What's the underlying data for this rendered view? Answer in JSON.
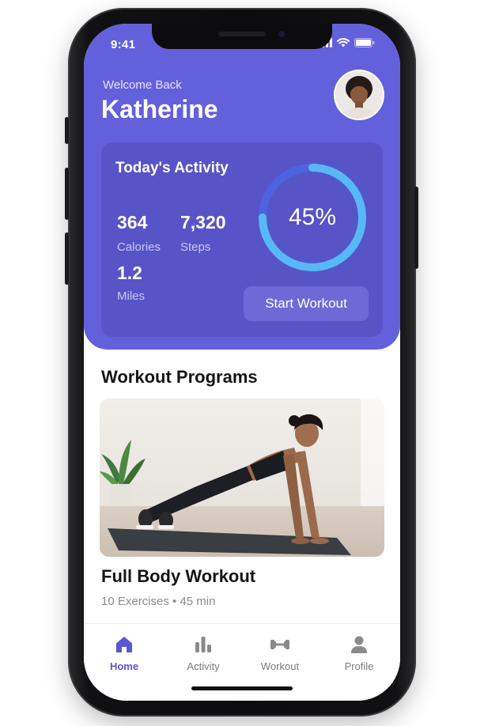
{
  "status_bar": {
    "time": "9:41"
  },
  "header": {
    "greeting": "Welcome Back",
    "user_name": "Katherine"
  },
  "activity": {
    "title": "Today's Activity",
    "calories_value": "364",
    "calories_label": "Calories",
    "steps_value": "7,320",
    "steps_label": "Steps",
    "miles_value": "1.2",
    "miles_label": "Miles",
    "progress_text": "45%",
    "progress_fraction": 0.75,
    "start_button": "Start Workout"
  },
  "programs": {
    "section_title": "Workout Programs",
    "items": [
      {
        "title": "Full Body Workout",
        "meta": "10 Exercises • 45 min"
      }
    ]
  },
  "tabbar": {
    "items": [
      {
        "label": "Home",
        "icon": "home-icon",
        "active": true
      },
      {
        "label": "Activity",
        "icon": "bar-chart-icon",
        "active": false
      },
      {
        "label": "Workout",
        "icon": "dumbbell-icon",
        "active": false
      },
      {
        "label": "Profile",
        "icon": "person-icon",
        "active": false
      }
    ]
  },
  "colors": {
    "primary": "#6360dc",
    "card": "#5754c8",
    "ring_track": "#4e63e0",
    "ring_fill": "#58b8f5",
    "active_tab": "#5a57d2"
  }
}
